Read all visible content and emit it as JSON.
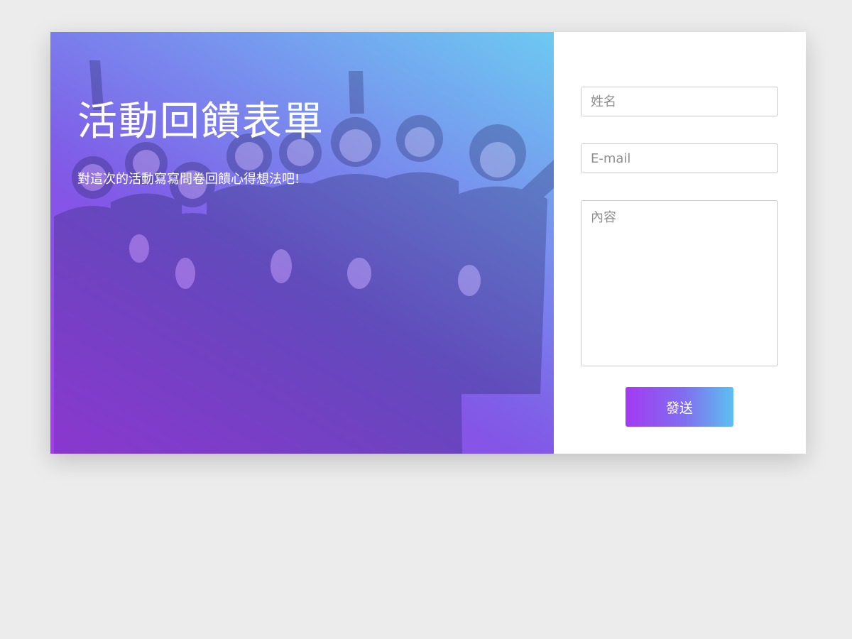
{
  "hero": {
    "title": "活動回饋表單",
    "subtitle": "對這次的活動寫寫問卷回饋心得想法吧!",
    "photo_icon": "team-thumbs-up-photo"
  },
  "form": {
    "name_placeholder": "姓名",
    "email_placeholder": "E-mail",
    "content_placeholder": "內容",
    "send_label": "發送"
  },
  "colors": {
    "page_background": "#ececec",
    "gradient_purple": "#a93df0",
    "gradient_blue": "#6ccaf2",
    "button_start": "#a43af2",
    "button_end": "#5cc0f0"
  }
}
